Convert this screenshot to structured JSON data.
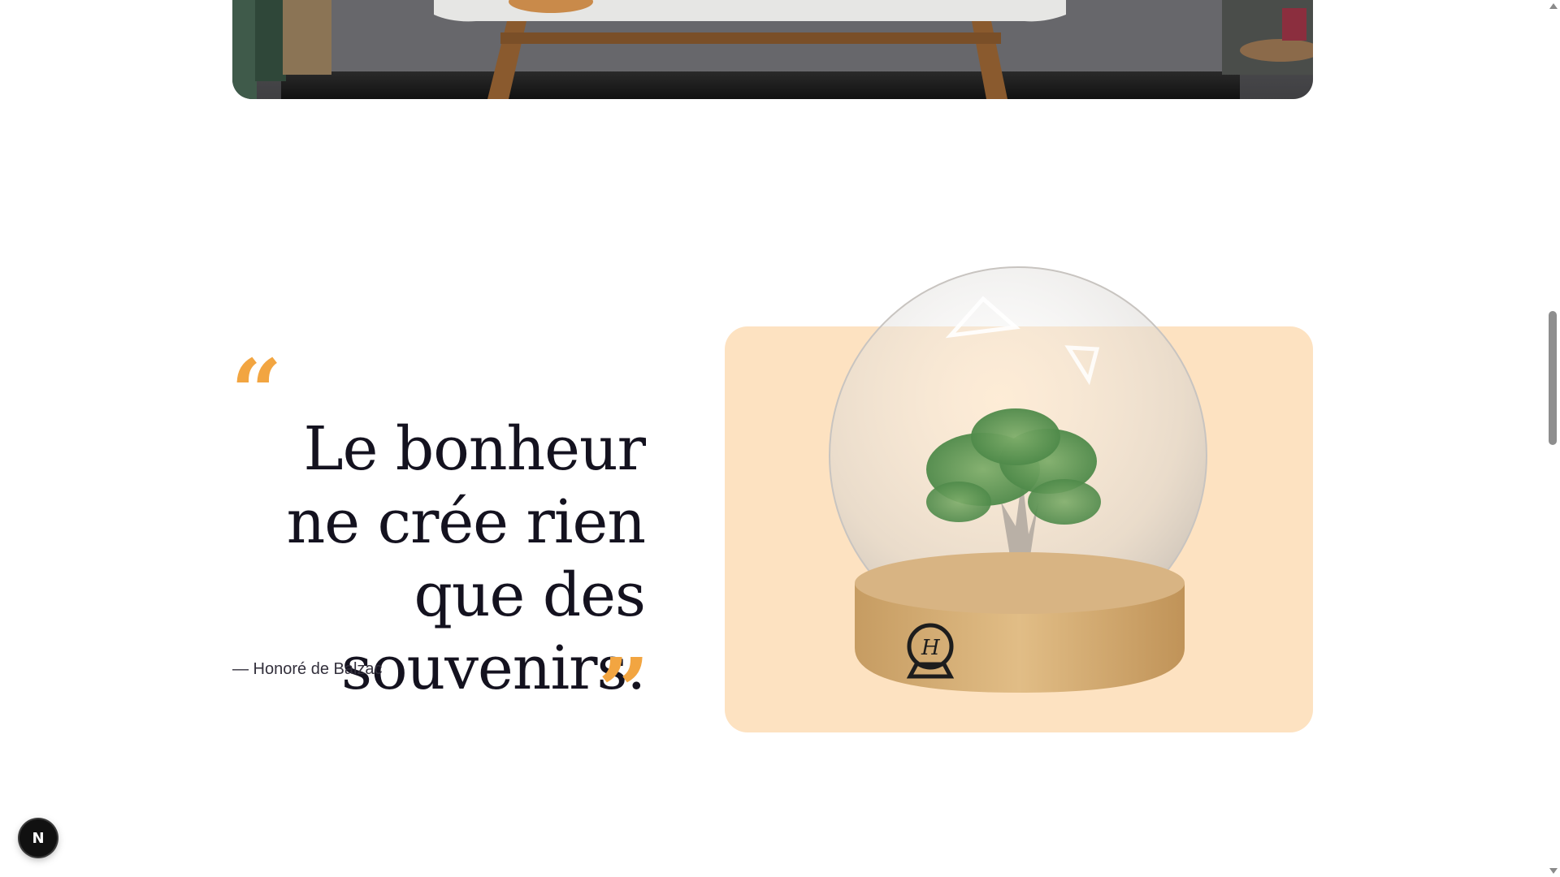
{
  "hero": {
    "image": "living-room-photo"
  },
  "quote": {
    "open_mark": "“",
    "text": "Le bonheur ne crée rien que des souvenirs.",
    "author": "— Honoré de Balzac",
    "close_mark": "”",
    "accent_color": "#f2a541",
    "text_color": "#14121f"
  },
  "illustration": {
    "image": "snow-globe-tree",
    "card_color": "#fde2c1"
  },
  "dev_tools": {
    "label": "N"
  },
  "scrollbar": {
    "thumb_color": "#8e8e8e"
  }
}
